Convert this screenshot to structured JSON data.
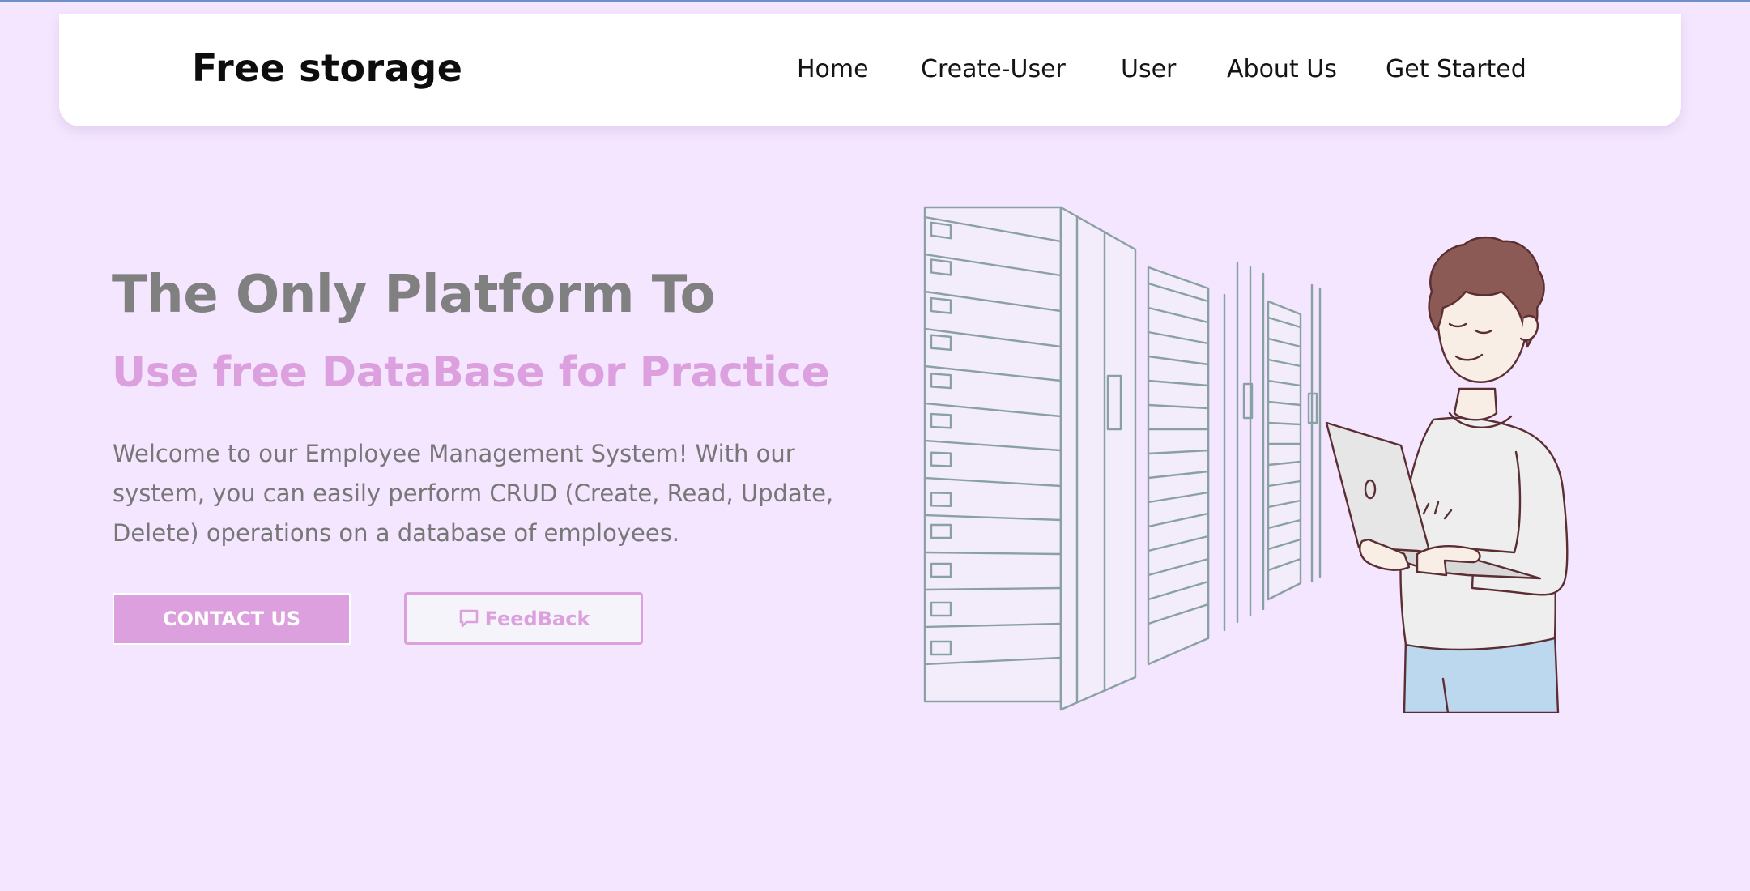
{
  "nav": {
    "brand": "Free storage",
    "links": [
      "Home",
      "Create-User",
      "User",
      "About Us",
      "Get Started"
    ]
  },
  "hero": {
    "title": "The Only Platform To",
    "subtitle": "Use free DataBase for Practice",
    "description": "Welcome to our Employee Management System! With our system, you can easily perform CRUD (Create, Read, Update, Delete) operations on a database of employees.",
    "contact_button": "CONTACT US",
    "feedback_button": "FeedBack",
    "feedback_icon": "chat-bubble-icon"
  },
  "colors": {
    "background": "#f4e6fe",
    "accent": "#dca0de",
    "title_gray": "#808080",
    "navbar_bg": "#ffffff"
  }
}
